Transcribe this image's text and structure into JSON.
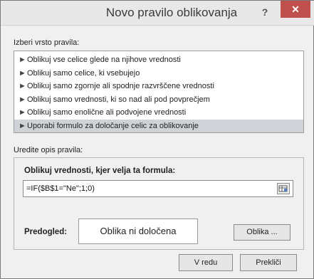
{
  "dialog": {
    "title": "Novo pravilo oblikovanja",
    "help_label": "?",
    "close_label": "✕"
  },
  "rule_type": {
    "label": "Izberi vrsto pravila:",
    "items": [
      {
        "label": "Oblikuj vse celice glede na njihove vrednosti"
      },
      {
        "label": "Oblikuj samo celice, ki vsebujejo"
      },
      {
        "label": "Oblikuj samo zgornje ali spodnje razvrščene vrednosti"
      },
      {
        "label": "Oblikuj samo vrednosti, ki so nad ali pod povprečjem"
      },
      {
        "label": "Oblikuj samo enolične ali podvojene vrednosti"
      },
      {
        "label": "Uporabi formulo za določanje celic za oblikovanje"
      }
    ],
    "arrow_glyph": "►"
  },
  "rule_description": {
    "label": "Uredite opis pravila:",
    "formula_label": "Oblikuj vrednosti, kjer velja ta formula:",
    "formula_value": "=IF($B$1=\"Ne\";1;0)",
    "preview_label": "Predogled:",
    "preview_text": "Oblika ni določena",
    "format_button": "Oblika ..."
  },
  "footer": {
    "ok_label": "V redu",
    "cancel_label": "Prekliči"
  }
}
